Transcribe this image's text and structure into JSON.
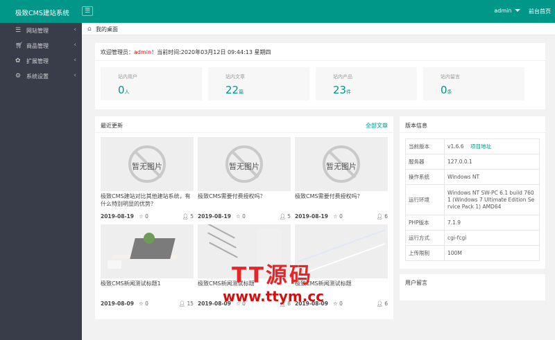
{
  "header": {
    "logo": "极致CMS建站系统",
    "menu_icon": "menu-icon",
    "user": "admin",
    "home_link": "前台首页",
    "brand_color": "#009688"
  },
  "sidebar": {
    "items": [
      {
        "label": "网站管理",
        "icon": "list-icon"
      },
      {
        "label": "商品管理",
        "icon": "cart-icon"
      },
      {
        "label": "扩展管理",
        "icon": "plugin-icon"
      },
      {
        "label": "系统设置",
        "icon": "gear-icon"
      }
    ]
  },
  "breadcrumb": {
    "title": "我的桌面"
  },
  "welcome": {
    "prefix": "欢迎管理员：",
    "admin": "admin",
    "suffix": "！当前时间:2020年03月12日 09:44:13 星期四"
  },
  "stats": [
    {
      "label": "站内用户",
      "value": "0",
      "unit": "人"
    },
    {
      "label": "站内文章",
      "value": "22",
      "unit": "篇"
    },
    {
      "label": "站内产品",
      "value": "23",
      "unit": "件"
    },
    {
      "label": "站内留言",
      "value": "0",
      "unit": "条"
    }
  ],
  "recent": {
    "title": "最近更新",
    "more": "全部文章",
    "no_image_text": "暂无图片",
    "articles": [
      {
        "title": "极致CMS建站对比其他建站系统，有什么特别明显的优势？",
        "date": "2019-08-19",
        "likes": "0",
        "views": "5",
        "image": "no-image"
      },
      {
        "title": "极致CMS需要付费授权吗？",
        "date": "2019-08-19",
        "likes": "0",
        "views": "5",
        "image": "no-image"
      },
      {
        "title": "极致CMS需要付费授权吗？",
        "date": "2019-08-19",
        "likes": "0",
        "views": "6",
        "image": "no-image"
      },
      {
        "title": "极致CMS新闻测试标题1",
        "date": "2019-08-09",
        "likes": "0",
        "views": "15",
        "image": "desk-photo"
      },
      {
        "title": "极致CMS新闻测试标题",
        "date": "2019-08-09",
        "likes": "0",
        "views": "8",
        "image": "stair-photo"
      },
      {
        "title": "极致CMS新闻测试标题",
        "date": "2019-08-09",
        "likes": "0",
        "views": "6",
        "image": "glass-photo"
      }
    ]
  },
  "version": {
    "title": "版本信息",
    "rows": [
      {
        "key": "当前版本",
        "value": "v1.6.6",
        "link": "项目地址"
      },
      {
        "key": "服务器",
        "value": "127.0.0.1"
      },
      {
        "key": "操作系统",
        "value": "Windows NT"
      },
      {
        "key": "运行环境",
        "value": "Windows NT SW-PC 6.1 build 7601 (Windows 7 Ultimate Edition Service Pack 1) AMD64"
      },
      {
        "key": "PHP版本",
        "value": "7.1.9"
      },
      {
        "key": "运行方式",
        "value": "cgi-fcgi"
      },
      {
        "key": "上传限制",
        "value": "100M"
      }
    ]
  },
  "messages": {
    "title": "用户留言"
  },
  "watermark": {
    "line1": "TT源码",
    "line2": "www.ttym.cc"
  }
}
